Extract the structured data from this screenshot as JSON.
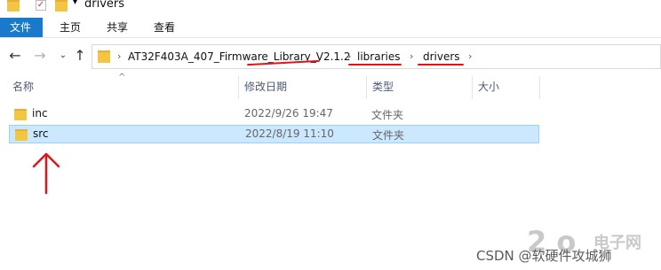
{
  "window": {
    "title": "drivers"
  },
  "ribbon": {
    "tabs": [
      "文件",
      "主页",
      "共享",
      "查看"
    ]
  },
  "address": {
    "crumbs": [
      "AT32F403A_407_Firmware_Library_V2.1.2",
      "libraries",
      "drivers"
    ]
  },
  "columns": {
    "name": "名称",
    "modified": "修改日期",
    "type": "类型",
    "size": "大小"
  },
  "rows": [
    {
      "name": "inc",
      "modified": "2022/9/26 19:47",
      "type": "文件夹",
      "selected": false
    },
    {
      "name": "src",
      "modified": "2022/8/19 11:10",
      "type": "文件夹",
      "selected": true
    }
  ],
  "watermark": {
    "text": "CSDN @软硬件攻城狮"
  },
  "colors": {
    "accent": "#1979ca",
    "annotation": "#e0151b",
    "selection": "#cce8ff"
  }
}
